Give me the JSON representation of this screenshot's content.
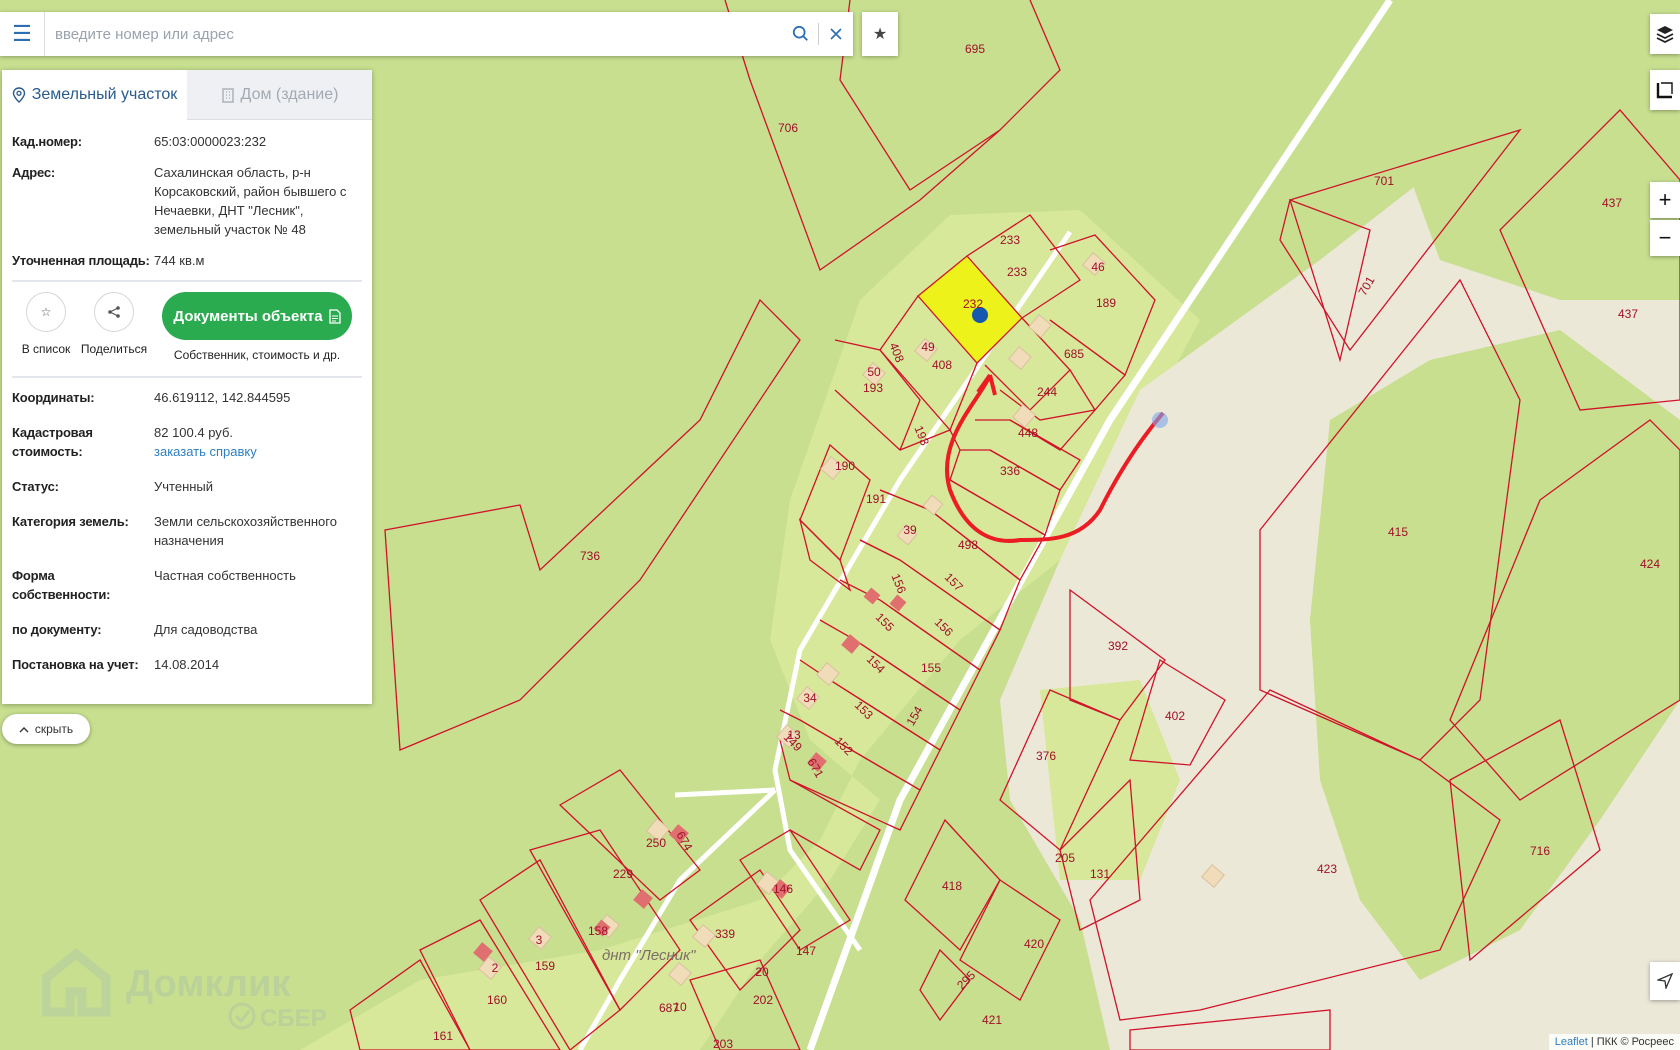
{
  "search": {
    "placeholder": "введите номер или адрес"
  },
  "tabs": [
    {
      "label": "Земельный участок",
      "icon": "location-pin-icon"
    },
    {
      "label": "Дом (здание)",
      "icon": "building-icon"
    }
  ],
  "parcel_info": {
    "cadastral_label": "Кад.номер:",
    "cadastral_value": "65:03:0000023:232",
    "address_label": "Адрес:",
    "address_value": "Сахалинская область, р-н Корсаковский, район бывшего с Нечаевки, ДНТ \"Лесник\", земельный участок № 48",
    "area_label": "Уточненная площадь:",
    "area_value": "744 кв.м"
  },
  "actions": {
    "add_list": "В список",
    "share": "Поделиться",
    "documents_button": "Документы объекта",
    "documents_sub": "Собственник, стоимость и др."
  },
  "details": {
    "coords_label": "Координаты:",
    "coords_value": "46.619112, 142.844595",
    "cost_label": "Кадастровая стоимость:",
    "cost_value": "82 100.4 руб.",
    "cost_link": "заказать справку",
    "status_label": "Статус:",
    "status_value": "Учтенный",
    "category_label": "Категория земель:",
    "category_value": "Земли сельскохозяйственного назначения",
    "ownership_label": "Форма собственности:",
    "ownership_value": "Частная собственность",
    "by_doc_label": "по документу:",
    "by_doc_value": "Для садоводства",
    "registered_label": "Постановка на учет:",
    "registered_value": "14.08.2014"
  },
  "hide_button": "скрыть",
  "zoom": {
    "in": "+",
    "out": "−"
  },
  "attribution": {
    "leaflet": "Leaflet",
    "rest": " | ПКК © Росреес"
  },
  "logo": {
    "brand": "Домклик",
    "sub": "СБЕР"
  },
  "map": {
    "settlement_label": "днт \"Лесник\"",
    "parcel_labels": [
      "695",
      "706",
      "233",
      "233",
      "46",
      "189",
      "232",
      "685",
      "244",
      "448",
      "336",
      "408",
      "49",
      "408",
      "50",
      "193",
      "193",
      "190",
      "191",
      "39",
      "498",
      "157",
      "156",
      "155",
      "156",
      "155",
      "154",
      "153",
      "154",
      "152",
      "149",
      "671",
      "34",
      "13",
      "701",
      "701",
      "437",
      "437",
      "415",
      "424",
      "736",
      "392",
      "402",
      "376",
      "205",
      "131",
      "418",
      "420",
      "295",
      "421",
      "423",
      "716",
      "250",
      "674",
      "229",
      "146",
      "158",
      "339",
      "147",
      "3",
      "159",
      "2",
      "160",
      "20",
      "202",
      "10",
      "687",
      "161",
      "203"
    ],
    "colors": {
      "parcel_border": "#d0122a",
      "selected_fill": "#ecf21a",
      "route": "#ec1c24",
      "forest": "#c7df8f",
      "clearing": "#d8e89a",
      "sand": "#ece8d8",
      "point": "#1558b0"
    }
  }
}
